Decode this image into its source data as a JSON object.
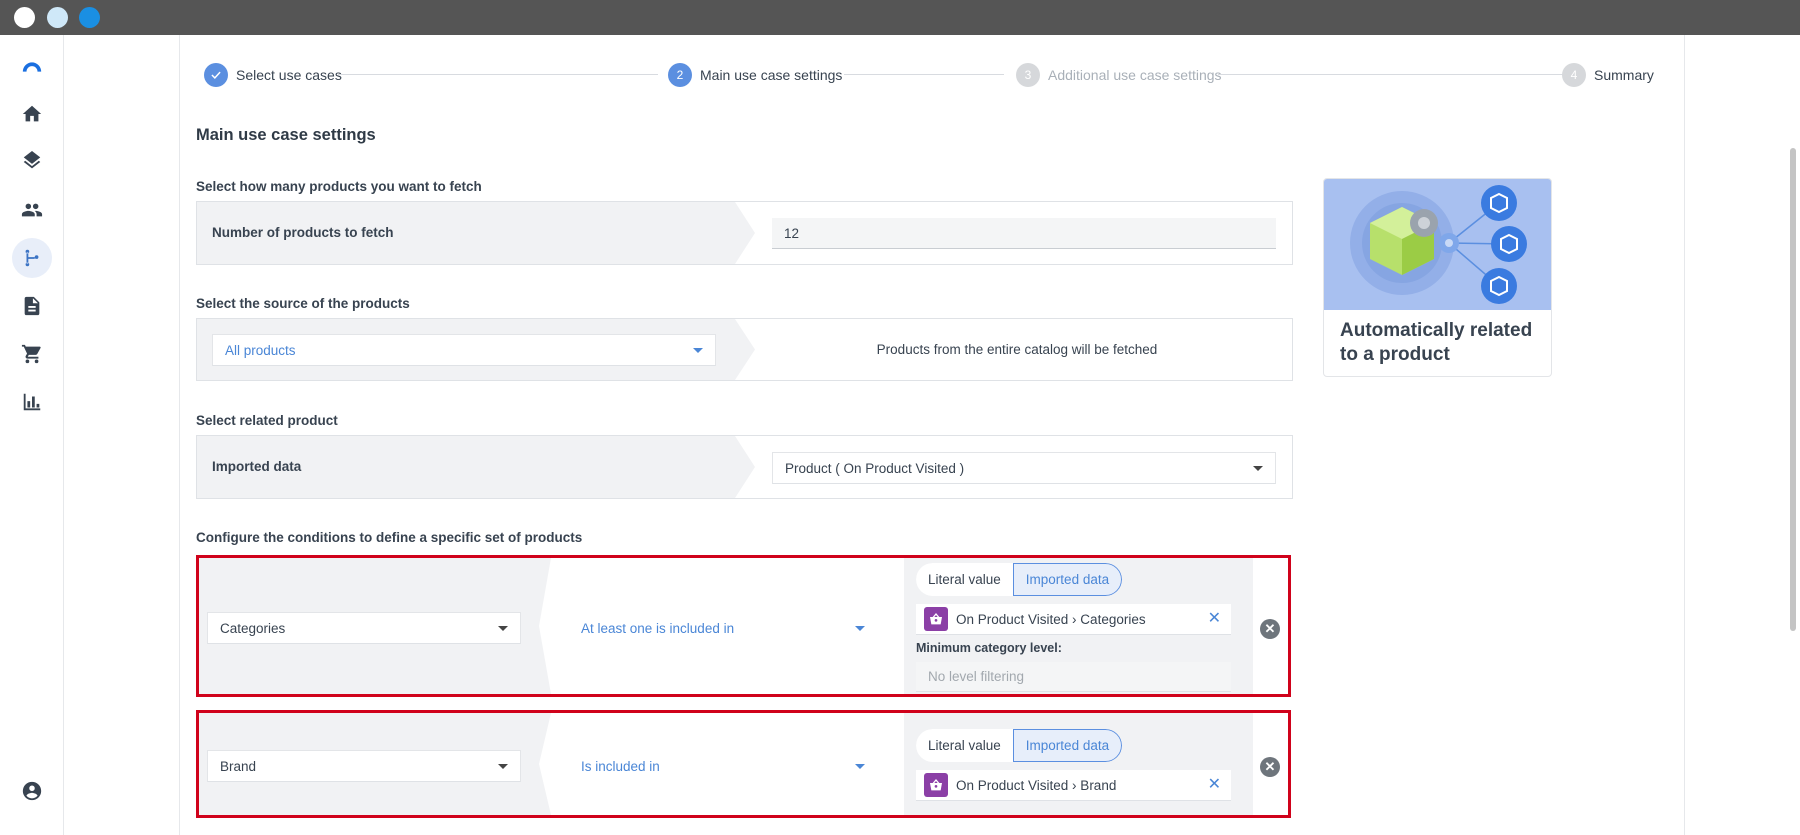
{
  "window": {
    "controls": [
      "close",
      "minimize",
      "maximize"
    ]
  },
  "sidebar": {
    "items": [
      {
        "icon": "logo-arc-icon"
      },
      {
        "icon": "home-icon"
      },
      {
        "icon": "layers-icon"
      },
      {
        "icon": "people-icon"
      },
      {
        "icon": "flow-branch-icon",
        "active": true
      },
      {
        "icon": "document-icon"
      },
      {
        "icon": "cart-icon"
      },
      {
        "icon": "bar-chart-icon"
      },
      {
        "icon": "account-icon"
      }
    ]
  },
  "stepper": {
    "steps": [
      {
        "number": "1",
        "label": "Select use cases",
        "state": "done"
      },
      {
        "number": "2",
        "label": "Main use case settings",
        "state": "current"
      },
      {
        "number": "3",
        "label": "Additional use case settings",
        "state": "todo"
      },
      {
        "number": "4",
        "label": "Summary",
        "state": "todo"
      }
    ]
  },
  "main": {
    "title": "Main use case settings",
    "fetch": {
      "section_label": "Select how many products you want to fetch",
      "row_label": "Number of products to fetch",
      "value": "12"
    },
    "source": {
      "section_label": "Select the source of the products",
      "selected": "All products",
      "description": "Products from the entire catalog will be fetched"
    },
    "related": {
      "section_label": "Select related product",
      "row_label": "Imported data",
      "selected": "Product ( On Product Visited )"
    },
    "conditions": {
      "section_label": "Configure the conditions to define a specific set of products",
      "rows": [
        {
          "attribute": "Categories",
          "operator": "At least one is included in",
          "toggle_literal": "Literal value",
          "toggle_imported": "Imported data",
          "chip": "On Product Visited › Categories",
          "min_label": "Minimum category level:",
          "min_placeholder": "No level filtering"
        },
        {
          "attribute": "Brand",
          "operator": "Is included in",
          "toggle_literal": "Literal value",
          "toggle_imported": "Imported data",
          "chip": "On Product Visited › Brand"
        }
      ]
    }
  },
  "card": {
    "title": "Automatically related to a product"
  },
  "colors": {
    "accent": "#5b8fe0",
    "highlight_border": "#d0021b",
    "chip_icon": "#8b3fa6",
    "card_art": "#a8c0f0"
  }
}
